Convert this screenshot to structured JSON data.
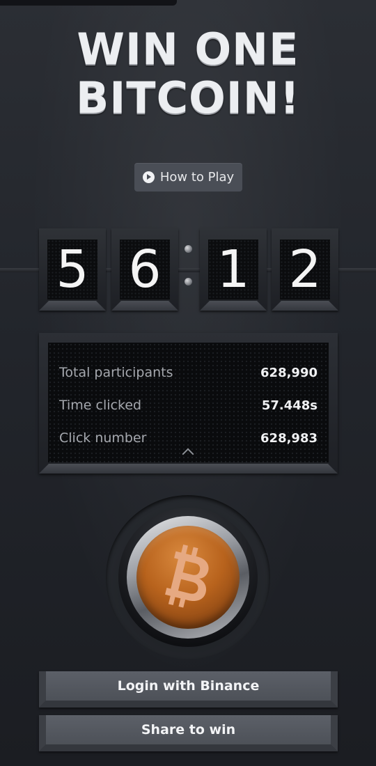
{
  "header": {
    "title_line1": "WIN ONE",
    "title_line2": "BITCOIN!"
  },
  "how_to_play": {
    "label": "How to Play",
    "icon": "play-circle-icon"
  },
  "timer": {
    "digits": [
      "5",
      "6",
      "1",
      "2"
    ]
  },
  "stats": {
    "rows": [
      {
        "label": "Total participants",
        "value": "628,990"
      },
      {
        "label": "Time clicked",
        "value": "57.448s"
      },
      {
        "label": "Click number",
        "value": "628,983"
      }
    ],
    "toggle_icon": "chevron-up-icon"
  },
  "bitcoin_button": {
    "icon": "bitcoin-icon"
  },
  "actions": {
    "login_label": "Login with Binance",
    "share_label": "Share to win"
  },
  "colors": {
    "background": "#24272d",
    "title": "#eceef1",
    "bitcoin_orange": "#b8631d",
    "button_face": "#5c6068"
  }
}
